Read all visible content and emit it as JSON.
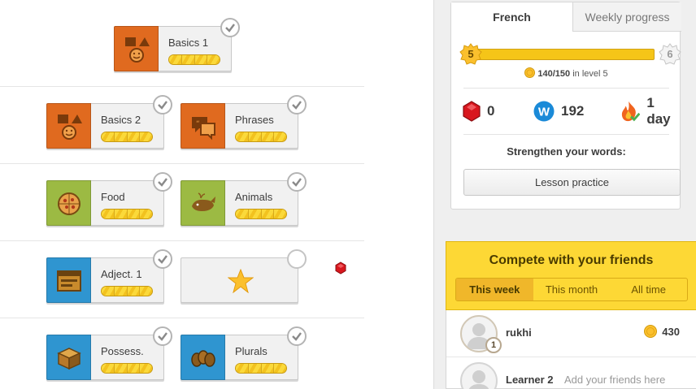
{
  "skills": {
    "basics1": {
      "label": "Basics 1"
    },
    "basics2": {
      "label": "Basics 2"
    },
    "phrases": {
      "label": "Phrases"
    },
    "food": {
      "label": "Food"
    },
    "animals": {
      "label": "Animals"
    },
    "adjectives": {
      "label": "Adject. 1"
    },
    "possessives": {
      "label": "Possess."
    },
    "plurals": {
      "label": "Plurals"
    }
  },
  "progress_panel": {
    "tabs": [
      "French",
      "Weekly progress"
    ],
    "level_current": "5",
    "level_next": "6",
    "xp_value": "140/150",
    "xp_suffix": "in level 5",
    "gems": "0",
    "words": "192",
    "streak": "1 day",
    "strengthen_label": "Strengthen your words:",
    "lesson_button": "Lesson practice"
  },
  "compete": {
    "title": "Compete with your friends",
    "periods": [
      "This week",
      "This month",
      "All time"
    ],
    "friends": [
      {
        "name": "rukhi",
        "rank": "1",
        "xp": "430"
      },
      {
        "name": "Learner 2",
        "hint": "Add your friends here"
      }
    ]
  },
  "colors": {
    "accent_yellow": "#fdd835",
    "orange_tile": "#e06a1f",
    "green_tile": "#9cba43",
    "blue_tile": "#2f95d0",
    "gem_red": "#d8171e",
    "words_blue": "#1a8ad8"
  }
}
